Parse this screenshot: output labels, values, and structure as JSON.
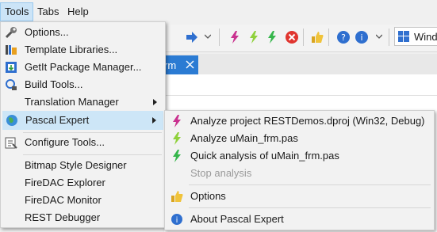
{
  "menubar": {
    "tools": "Tools",
    "tabs": "Tabs",
    "help": "Help"
  },
  "window_combo": {
    "label": "Wind"
  },
  "editor_tab": {
    "title": "rm"
  },
  "tools_menu": {
    "items": [
      {
        "label": "Options...",
        "icon": "wrench-icon"
      },
      {
        "label": "Template Libraries...",
        "icon": "template-library-icon"
      },
      {
        "label": "GetIt Package Manager...",
        "icon": "package-manager-icon"
      },
      {
        "label": "Build Tools...",
        "icon": "build-tools-icon"
      },
      {
        "label": "Translation Manager",
        "icon": "",
        "submenu": true
      },
      {
        "label": "Pascal Expert",
        "icon": "globe-icon",
        "submenu": true,
        "highlighted": true
      },
      {
        "label": "Configure Tools...",
        "icon": "configure-tools-icon"
      },
      {
        "label": "Bitmap Style Designer",
        "icon": ""
      },
      {
        "label": "FireDAC Explorer",
        "icon": ""
      },
      {
        "label": "FireDAC Monitor",
        "icon": ""
      },
      {
        "label": "REST Debugger",
        "icon": ""
      }
    ]
  },
  "pascal_expert_menu": {
    "items": [
      {
        "label": "Analyze project RESTDemos.dproj (Win32, Debug)",
        "icon": "analyze-project-icon"
      },
      {
        "label": "Analyze uMain_frm.pas",
        "icon": "analyze-file-icon"
      },
      {
        "label": "Quick analysis of uMain_frm.pas",
        "icon": "quick-analysis-icon"
      },
      {
        "label": "Stop analysis",
        "icon": "",
        "disabled": true
      },
      {
        "label": "Options",
        "icon": "pascal-expert-options-icon"
      },
      {
        "label": "About Pascal Expert",
        "icon": "info-icon"
      }
    ]
  },
  "colors": {
    "highlight": "#cde6f7",
    "menu_bg": "#f2f2f2",
    "tab_active": "#2b7bd3"
  }
}
